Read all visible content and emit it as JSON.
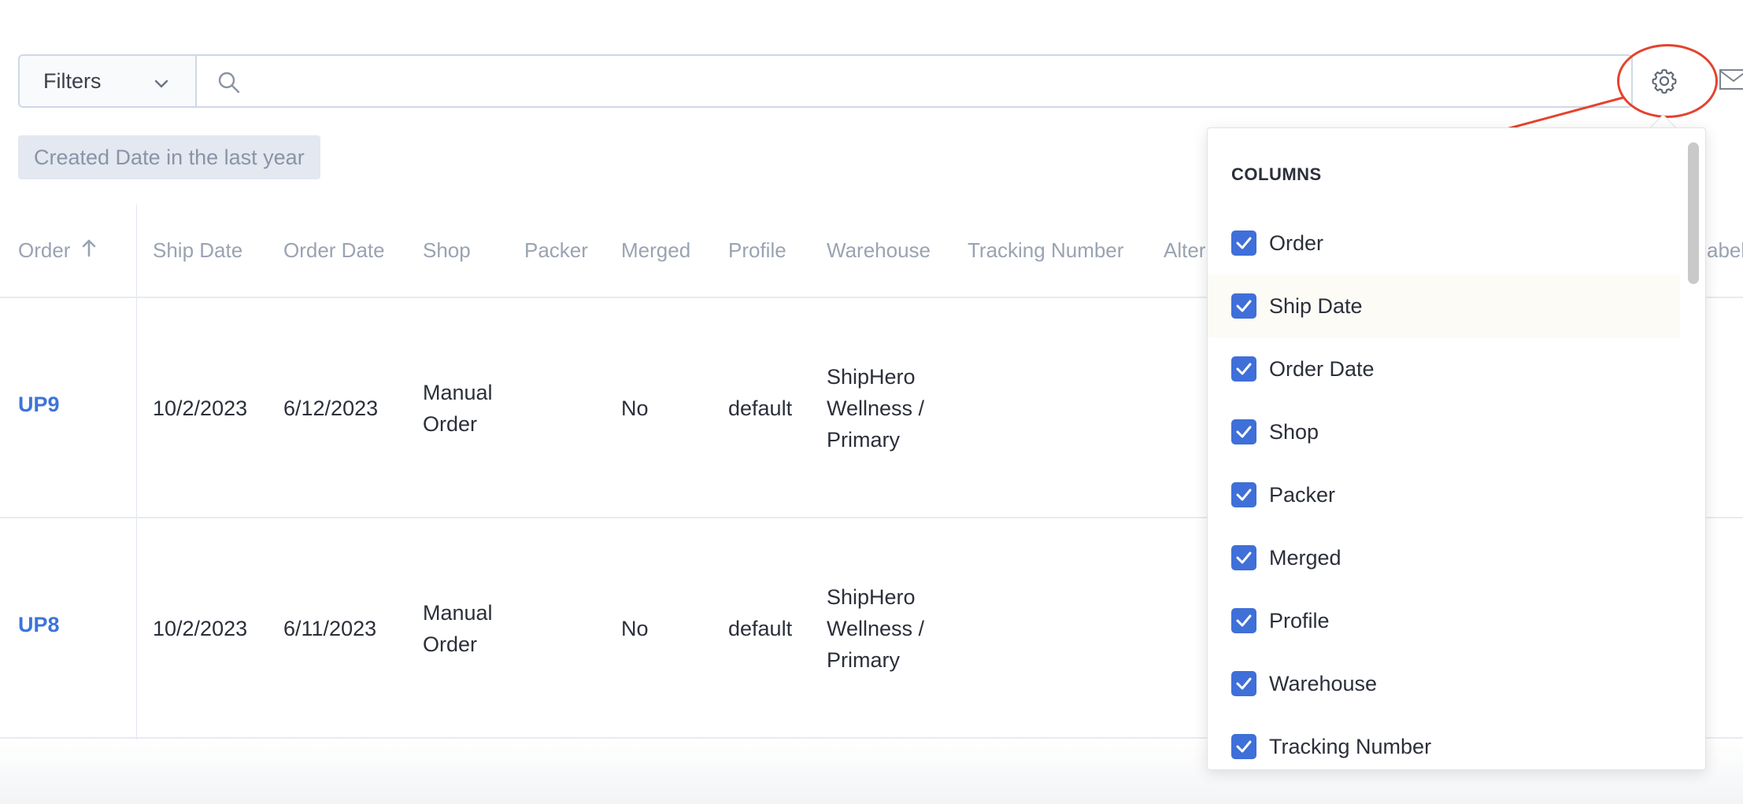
{
  "toolbar": {
    "filters_label": "Filters",
    "search_placeholder": ""
  },
  "chip": {
    "label": "Created Date in the last year"
  },
  "table": {
    "headers": [
      "Order",
      "Ship Date",
      "Order Date",
      "Shop",
      "Packer",
      "Merged",
      "Profile",
      "Warehouse",
      "Tracking Number",
      "Alter",
      "abel"
    ],
    "rows": [
      {
        "order": "UP9",
        "ship_date": "10/2/2023",
        "order_date": "6/12/2023",
        "shop": [
          "Manual",
          "Order"
        ],
        "packer": "",
        "merged": "No",
        "profile": "default",
        "warehouse": [
          "ShipHero",
          "Wellness /",
          "Primary"
        ]
      },
      {
        "order": "UP8",
        "ship_date": "10/2/2023",
        "order_date": "6/11/2023",
        "shop": [
          "Manual",
          "Order"
        ],
        "packer": "",
        "merged": "No",
        "profile": "default",
        "warehouse": [
          "ShipHero",
          "Wellness /",
          "Primary"
        ]
      }
    ]
  },
  "columns_panel": {
    "title": "COLUMNS",
    "items": [
      {
        "label": "Order",
        "checked": true
      },
      {
        "label": "Ship Date",
        "checked": true
      },
      {
        "label": "Order Date",
        "checked": true
      },
      {
        "label": "Shop",
        "checked": true
      },
      {
        "label": "Packer",
        "checked": true
      },
      {
        "label": "Merged",
        "checked": true
      },
      {
        "label": "Profile",
        "checked": true
      },
      {
        "label": "Warehouse",
        "checked": true
      },
      {
        "label": "Tracking Number",
        "checked": true
      }
    ]
  },
  "colors": {
    "accent": "#3f6fd8",
    "link": "#3d74d8",
    "annotation": "#e4432e"
  },
  "icons": [
    "chevron-down-icon",
    "search-icon",
    "gear-icon",
    "mail-icon",
    "sort-arrow-up-icon",
    "checkbox-checked-icon"
  ]
}
